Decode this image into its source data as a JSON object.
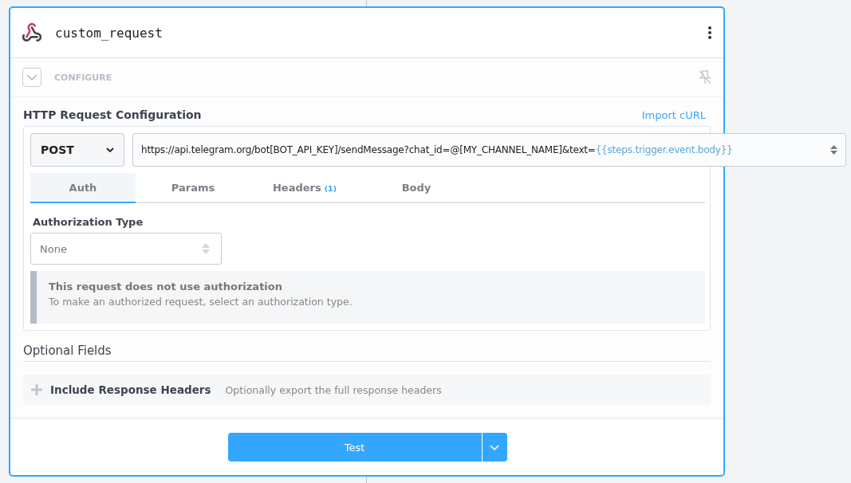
{
  "step": {
    "title": "custom_request"
  },
  "section": {
    "label": "CONFIGURE",
    "expanded": true
  },
  "config": {
    "title": "HTTP Request Configuration",
    "import_link": "Import cURL",
    "method": "POST",
    "url": [
      {
        "kind": "literal",
        "text": "https://api.telegram.org/bot[BOT_API_KEY]/sendMessage?chat_id=@[MY_CHANNEL_NAME]&text="
      },
      {
        "kind": "expression",
        "text": "{{steps.trigger.event.body}}"
      }
    ],
    "tabs": [
      {
        "label": "Auth",
        "selected": true
      },
      {
        "label": "Params",
        "selected": false
      },
      {
        "label": "Headers",
        "badge": "(1)",
        "selected": false
      },
      {
        "label": "Body",
        "selected": false
      }
    ],
    "auth": {
      "label": "Authorization Type",
      "value": "None",
      "notice_title": "This request does not use authorization",
      "notice_text": "To make an authorized request, select an authorization type."
    }
  },
  "optional": {
    "title": "Optional Fields",
    "items": [
      {
        "label": "Include Response Headers",
        "description": "Optionally export the full response headers"
      }
    ]
  },
  "actions": {
    "test": "Test"
  }
}
